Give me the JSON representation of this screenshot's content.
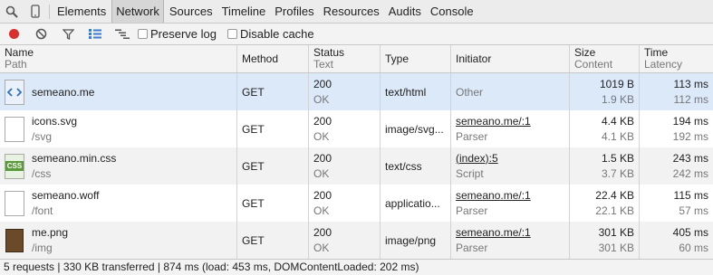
{
  "tabs": [
    "Elements",
    "Network",
    "Sources",
    "Timeline",
    "Profiles",
    "Resources",
    "Audits",
    "Console"
  ],
  "active_tab": "Network",
  "toolbar": {
    "preserve_log_label": "Preserve log",
    "disable_cache_label": "Disable cache",
    "icons": [
      "record-icon",
      "clear-icon",
      "filter-icon",
      "large-rows-icon",
      "overview-icon"
    ],
    "record_color": "#d9302f"
  },
  "columns": {
    "name": {
      "primary": "Name",
      "secondary": "Path"
    },
    "method": {
      "primary": "Method"
    },
    "status": {
      "primary": "Status",
      "secondary": "Text"
    },
    "type": {
      "primary": "Type"
    },
    "initiator": {
      "primary": "Initiator"
    },
    "size": {
      "primary": "Size",
      "secondary": "Content"
    },
    "time": {
      "primary": "Time",
      "secondary": "Latency"
    }
  },
  "rows": [
    {
      "name": "semeano.me",
      "path": "",
      "icon": "html-file-icon",
      "method": "GET",
      "status": "200",
      "status_text": "OK",
      "type": "text/html",
      "initiator": "Other",
      "initiator_sub": "",
      "size": "1019 B",
      "content": "1.9 KB",
      "time": "113 ms",
      "latency": "112 ms"
    },
    {
      "name": "icons.svg",
      "path": "/svg",
      "icon": "file-icon",
      "method": "GET",
      "status": "200",
      "status_text": "OK",
      "type": "image/svg...",
      "initiator": "semeano.me/:1",
      "initiator_sub": "Parser",
      "size": "4.4 KB",
      "content": "4.1 KB",
      "time": "194 ms",
      "latency": "192 ms"
    },
    {
      "name": "semeano.min.css",
      "path": "/css",
      "icon": "css-file-icon",
      "method": "GET",
      "status": "200",
      "status_text": "OK",
      "type": "text/css",
      "initiator": "(index):5",
      "initiator_sub": "Script",
      "size": "1.5 KB",
      "content": "3.7 KB",
      "time": "243 ms",
      "latency": "242 ms"
    },
    {
      "name": "semeano.woff",
      "path": "/font",
      "icon": "file-icon",
      "method": "GET",
      "status": "200",
      "status_text": "OK",
      "type": "applicatio...",
      "initiator": "semeano.me/:1",
      "initiator_sub": "Parser",
      "size": "22.4 KB",
      "content": "22.1 KB",
      "time": "115 ms",
      "latency": "57 ms"
    },
    {
      "name": "me.png",
      "path": "/img",
      "icon": "image-thumbnail-icon",
      "method": "GET",
      "status": "200",
      "status_text": "OK",
      "type": "image/png",
      "initiator": "semeano.me/:1",
      "initiator_sub": "Parser",
      "size": "301 KB",
      "content": "301 KB",
      "time": "405 ms",
      "latency": "60 ms"
    }
  ],
  "summary": "5 requests | 330 KB transferred | 874 ms (load: 453 ms, DOMContentLoaded: 202 ms)"
}
